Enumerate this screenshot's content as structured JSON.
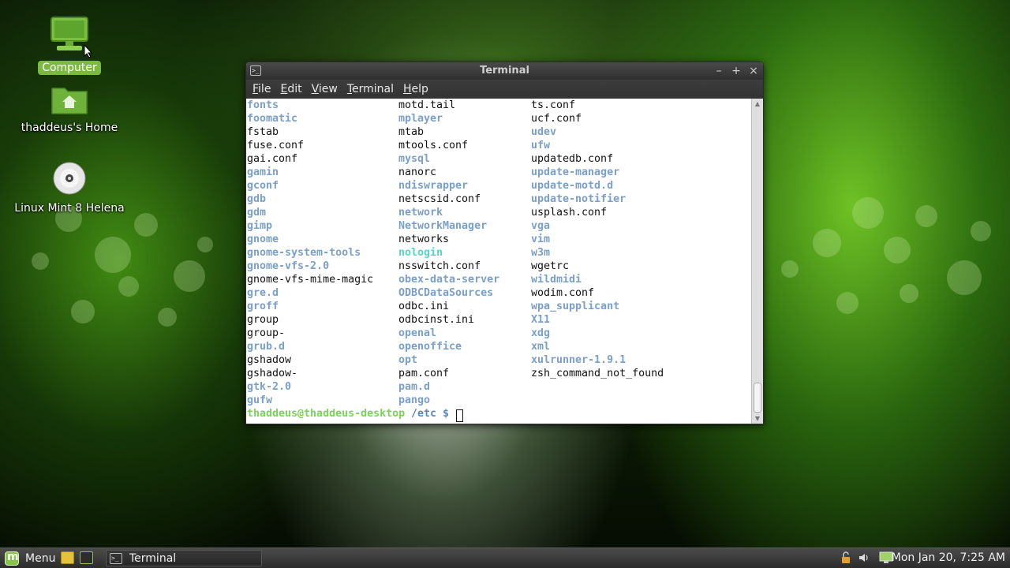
{
  "desktop": {
    "icons": [
      {
        "label": "Computer",
        "icon": "computer-icon"
      },
      {
        "label": "thaddeus's Home",
        "icon": "home-folder-icon"
      },
      {
        "label": "Linux Mint 8 Helena",
        "icon": "cd-disc-icon"
      }
    ]
  },
  "window": {
    "title": "Terminal",
    "controls": {
      "minimize": "–",
      "maximize": "+",
      "close": "×"
    },
    "menu": [
      "File",
      "Edit",
      "View",
      "Terminal",
      "Help"
    ]
  },
  "terminal": {
    "rows": [
      [
        {
          "t": "fonts",
          "c": "dir"
        },
        {
          "t": "motd.tail",
          "c": "plain"
        },
        {
          "t": "ts.conf",
          "c": "plain"
        }
      ],
      [
        {
          "t": "foomatic",
          "c": "dir"
        },
        {
          "t": "mplayer",
          "c": "dir"
        },
        {
          "t": "ucf.conf",
          "c": "plain"
        }
      ],
      [
        {
          "t": "fstab",
          "c": "plain"
        },
        {
          "t": "mtab",
          "c": "plain"
        },
        {
          "t": "udev",
          "c": "dir"
        }
      ],
      [
        {
          "t": "fuse.conf",
          "c": "plain"
        },
        {
          "t": "mtools.conf",
          "c": "plain"
        },
        {
          "t": "ufw",
          "c": "dir"
        }
      ],
      [
        {
          "t": "gai.conf",
          "c": "plain"
        },
        {
          "t": "mysql",
          "c": "dir"
        },
        {
          "t": "updatedb.conf",
          "c": "plain"
        }
      ],
      [
        {
          "t": "gamin",
          "c": "dir"
        },
        {
          "t": "nanorc",
          "c": "plain"
        },
        {
          "t": "update-manager",
          "c": "dir"
        }
      ],
      [
        {
          "t": "gconf",
          "c": "dir"
        },
        {
          "t": "ndiswrapper",
          "c": "dir"
        },
        {
          "t": "update-motd.d",
          "c": "dir"
        }
      ],
      [
        {
          "t": "gdb",
          "c": "dir"
        },
        {
          "t": "netscsid.conf",
          "c": "plain"
        },
        {
          "t": "update-notifier",
          "c": "dir"
        }
      ],
      [
        {
          "t": "gdm",
          "c": "dir"
        },
        {
          "t": "network",
          "c": "dir"
        },
        {
          "t": "usplash.conf",
          "c": "plain"
        }
      ],
      [
        {
          "t": "gimp",
          "c": "dir"
        },
        {
          "t": "NetworkManager",
          "c": "dir"
        },
        {
          "t": "vga",
          "c": "dir"
        }
      ],
      [
        {
          "t": "gnome",
          "c": "dir"
        },
        {
          "t": "networks",
          "c": "plain"
        },
        {
          "t": "vim",
          "c": "dir"
        }
      ],
      [
        {
          "t": "gnome-system-tools",
          "c": "dir"
        },
        {
          "t": "nologin",
          "c": "orphan"
        },
        {
          "t": "w3m",
          "c": "dir"
        }
      ],
      [
        {
          "t": "gnome-vfs-2.0",
          "c": "dir"
        },
        {
          "t": "nsswitch.conf",
          "c": "plain"
        },
        {
          "t": "wgetrc",
          "c": "plain"
        }
      ],
      [
        {
          "t": "gnome-vfs-mime-magic",
          "c": "plain"
        },
        {
          "t": "obex-data-server",
          "c": "dir"
        },
        {
          "t": "wildmidi",
          "c": "dir"
        }
      ],
      [
        {
          "t": "gre.d",
          "c": "dir"
        },
        {
          "t": "ODBCDataSources",
          "c": "dir"
        },
        {
          "t": "wodim.conf",
          "c": "plain"
        }
      ],
      [
        {
          "t": "groff",
          "c": "dir"
        },
        {
          "t": "odbc.ini",
          "c": "plain"
        },
        {
          "t": "wpa_supplicant",
          "c": "dir"
        }
      ],
      [
        {
          "t": "group",
          "c": "plain"
        },
        {
          "t": "odbcinst.ini",
          "c": "plain"
        },
        {
          "t": "X11",
          "c": "dir"
        }
      ],
      [
        {
          "t": "group-",
          "c": "plain"
        },
        {
          "t": "openal",
          "c": "dir"
        },
        {
          "t": "xdg",
          "c": "dir"
        }
      ],
      [
        {
          "t": "grub.d",
          "c": "dir"
        },
        {
          "t": "openoffice",
          "c": "dir"
        },
        {
          "t": "xml",
          "c": "dir"
        }
      ],
      [
        {
          "t": "gshadow",
          "c": "plain"
        },
        {
          "t": "opt",
          "c": "dir"
        },
        {
          "t": "xulrunner-1.9.1",
          "c": "dir"
        }
      ],
      [
        {
          "t": "gshadow-",
          "c": "plain"
        },
        {
          "t": "pam.conf",
          "c": "plain"
        },
        {
          "t": "zsh_command_not_found",
          "c": "plain"
        }
      ],
      [
        {
          "t": "gtk-2.0",
          "c": "dir"
        },
        {
          "t": "pam.d",
          "c": "dir"
        },
        {
          "t": "",
          "c": "plain"
        }
      ],
      [
        {
          "t": "gufw",
          "c": "dir"
        },
        {
          "t": "pango",
          "c": "dir"
        },
        {
          "t": "",
          "c": "plain"
        }
      ]
    ],
    "prompt": {
      "user_host": "thaddeus@thaddeus-desktop",
      "path": "/etc $"
    }
  },
  "panel": {
    "menu_label": "Menu",
    "task_label": "Terminal",
    "clock": "Mon Jan 20,  7:25 AM"
  },
  "colors": {
    "dir": "#7a9fc9",
    "orphan": "#55d4c8",
    "prompt_user": "#7bd25a",
    "mint_green": "#8ac34a"
  }
}
